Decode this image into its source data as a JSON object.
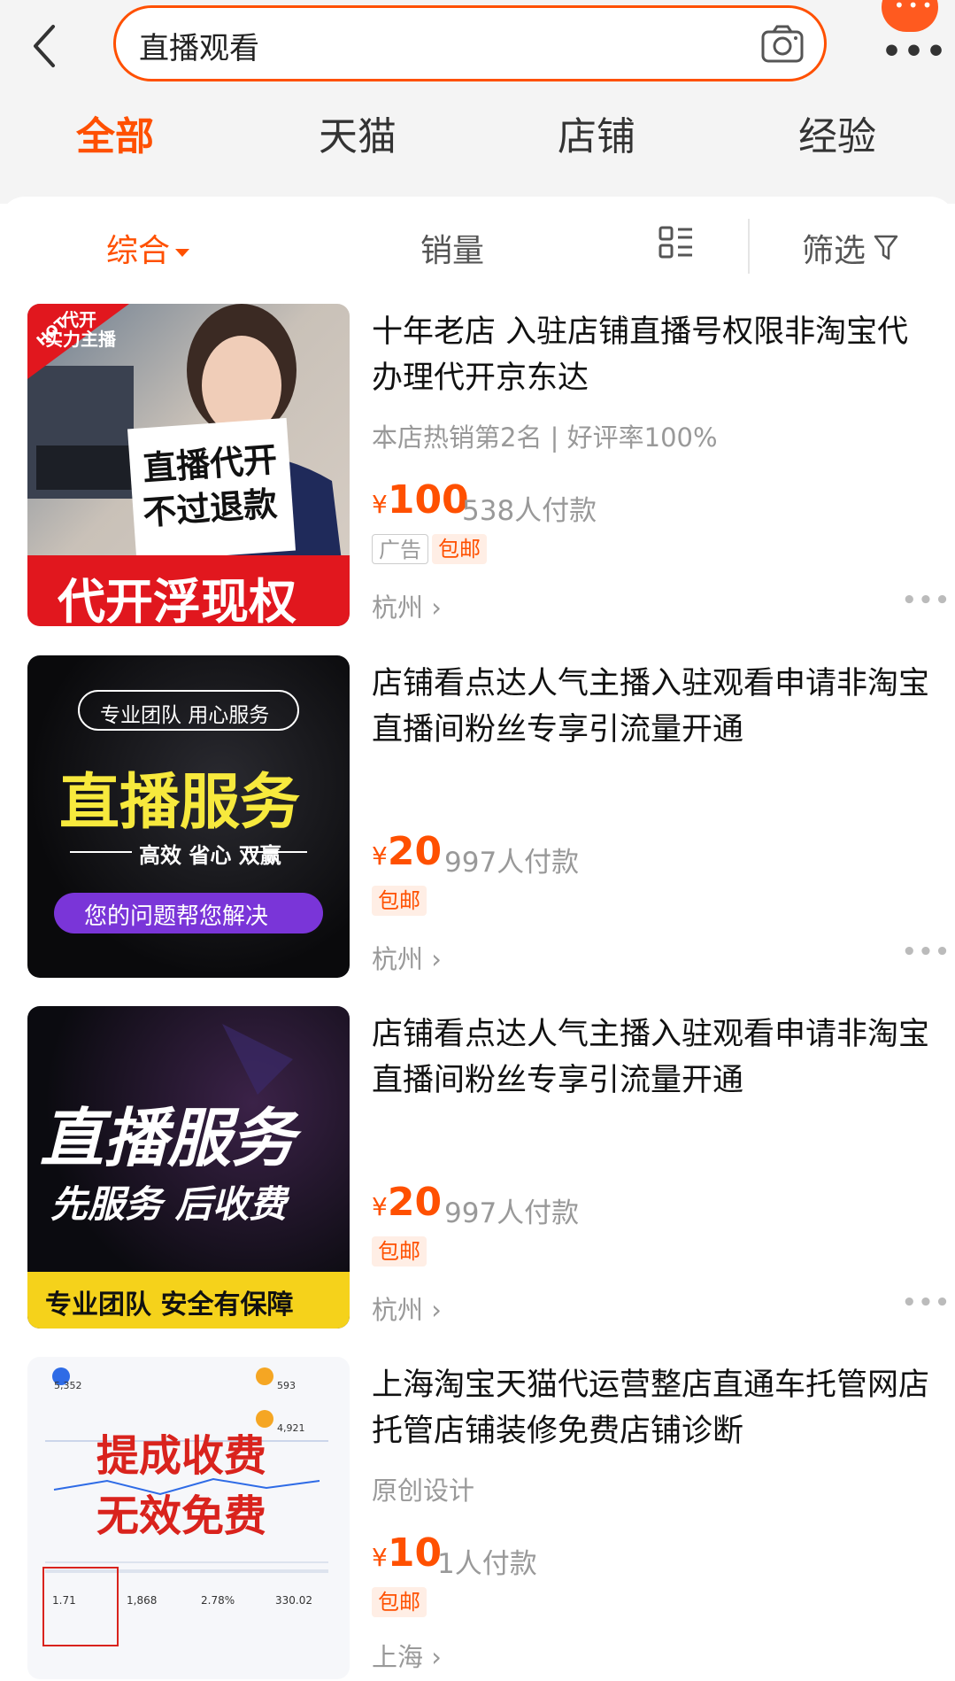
{
  "search": {
    "query": "直播观看"
  },
  "tabs": [
    "全部",
    "天猫",
    "店铺",
    "经验"
  ],
  "sort": {
    "comprehensive": "综合",
    "sales": "销量",
    "filter": "筛选"
  },
  "products": [
    {
      "title": "十年老店 入驻店铺直播号权限非淘宝代办理代开京东达",
      "subtitle": "本店热销第2名 | 好评率100%",
      "price_symbol": "¥",
      "price": "100",
      "sold": "538人付款",
      "tag_ad": "广告",
      "tag_shipping": "包邮",
      "location": "杭州 ›",
      "thumb": {
        "hot_badge": "HOT",
        "corner_line1": "代开",
        "corner_line2": "实力主播",
        "sign_line1": "直播代开",
        "sign_line2": "不过退款",
        "banner": "代开浮现权"
      }
    },
    {
      "title": "店铺看点达人气主播入驻观看申请非淘宝直播间粉丝专享引流量开通",
      "price_symbol": "¥",
      "price": "20",
      "sold": "997人付款",
      "tag_shipping": "包邮",
      "location": "杭州 ›",
      "thumb": {
        "pill": "专业团队 用心服务",
        "headline": "直播服务",
        "slogan": "高效 省心 双赢",
        "button": "您的问题帮您解决"
      }
    },
    {
      "title": "店铺看点达人气主播入驻观看申请非淘宝直播间粉丝专享引流量开通",
      "price_symbol": "¥",
      "price": "20",
      "sold": "997人付款",
      "tag_shipping": "包邮",
      "location": "杭州 ›",
      "thumb": {
        "headline": "直播服务",
        "line2": "先服务 后收费",
        "banner": "专业团队 安全有保障"
      }
    },
    {
      "title": "上海淘宝天猫代运营整店直通车托管网店托管店铺装修免费店铺诊断",
      "subtitle": "原创设计",
      "price_symbol": "¥",
      "price": "10",
      "sold": "1人付款",
      "tag_shipping": "包邮",
      "location": "上海 ›",
      "thumb": {
        "line1": "提成收费",
        "line2": "无效免费",
        "stat1": "5,352",
        "stat2": "593",
        "stat3": "4,921",
        "stat4": "1.71",
        "stat5": "1,868",
        "stat6": "2.78%",
        "stat7": "330.02"
      }
    }
  ],
  "colors": {
    "accent": "#ff5000",
    "tag_bg": "#ffeee5",
    "muted": "#999999"
  }
}
